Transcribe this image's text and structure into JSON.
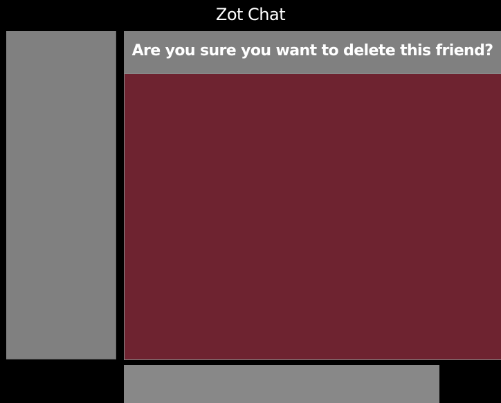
{
  "app": {
    "title": "Zot Chat"
  },
  "dialog": {
    "prompt": "Are you sure you want to delete this friend?"
  },
  "colors": {
    "background": "#000000",
    "panel_gray": "#808080",
    "content_maroon": "#6e2330",
    "text": "#ffffff"
  }
}
